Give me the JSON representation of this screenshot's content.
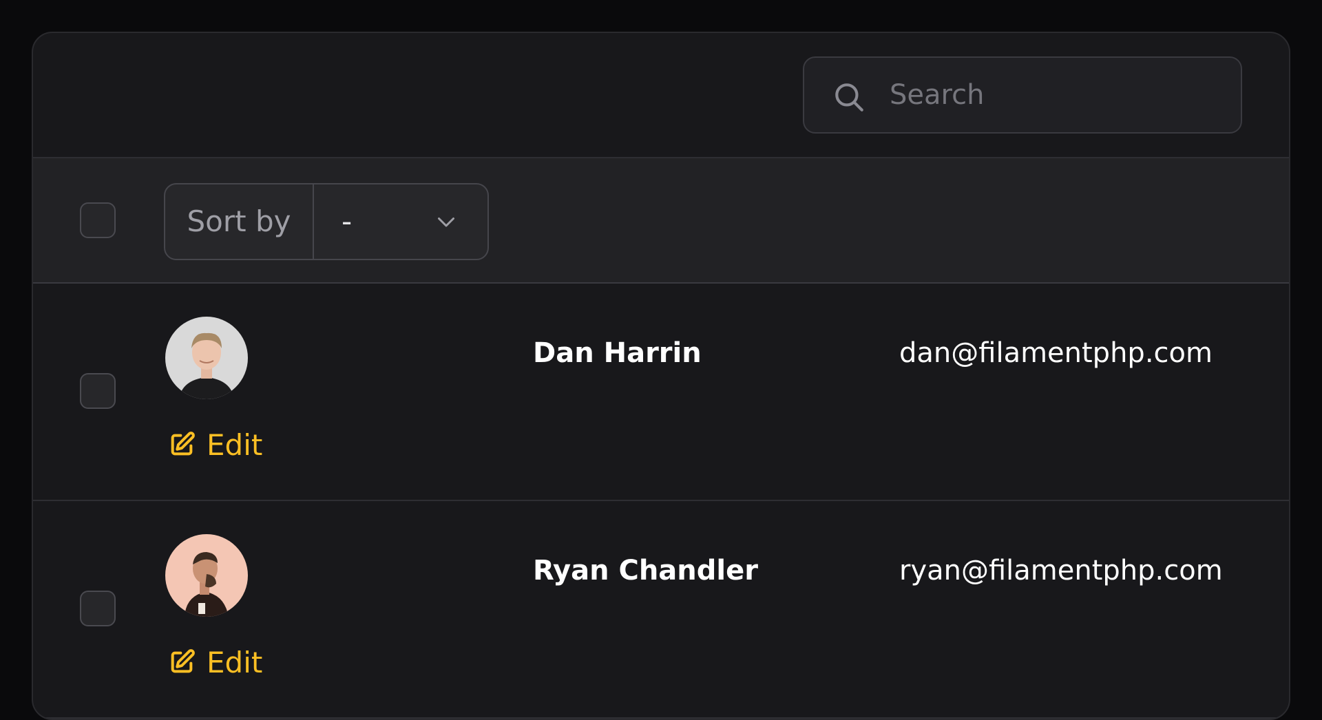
{
  "search": {
    "placeholder": "Search",
    "value": ""
  },
  "sort": {
    "label": "Sort by",
    "selected": "-"
  },
  "rows": [
    {
      "name": "Dan Harrin",
      "email": "dan@filamentphp.com",
      "edit_label": "Edit",
      "avatar_bg": "#d4d4d4"
    },
    {
      "name": "Ryan Chandler",
      "email": "ryan@filamentphp.com",
      "edit_label": "Edit",
      "avatar_bg": "#f3c3b0"
    }
  ],
  "colors": {
    "background": "#0a0a0c",
    "panel": "#18181b",
    "accent": "#fbbf24",
    "text": "#ffffff",
    "muted": "#9f9fa6"
  }
}
